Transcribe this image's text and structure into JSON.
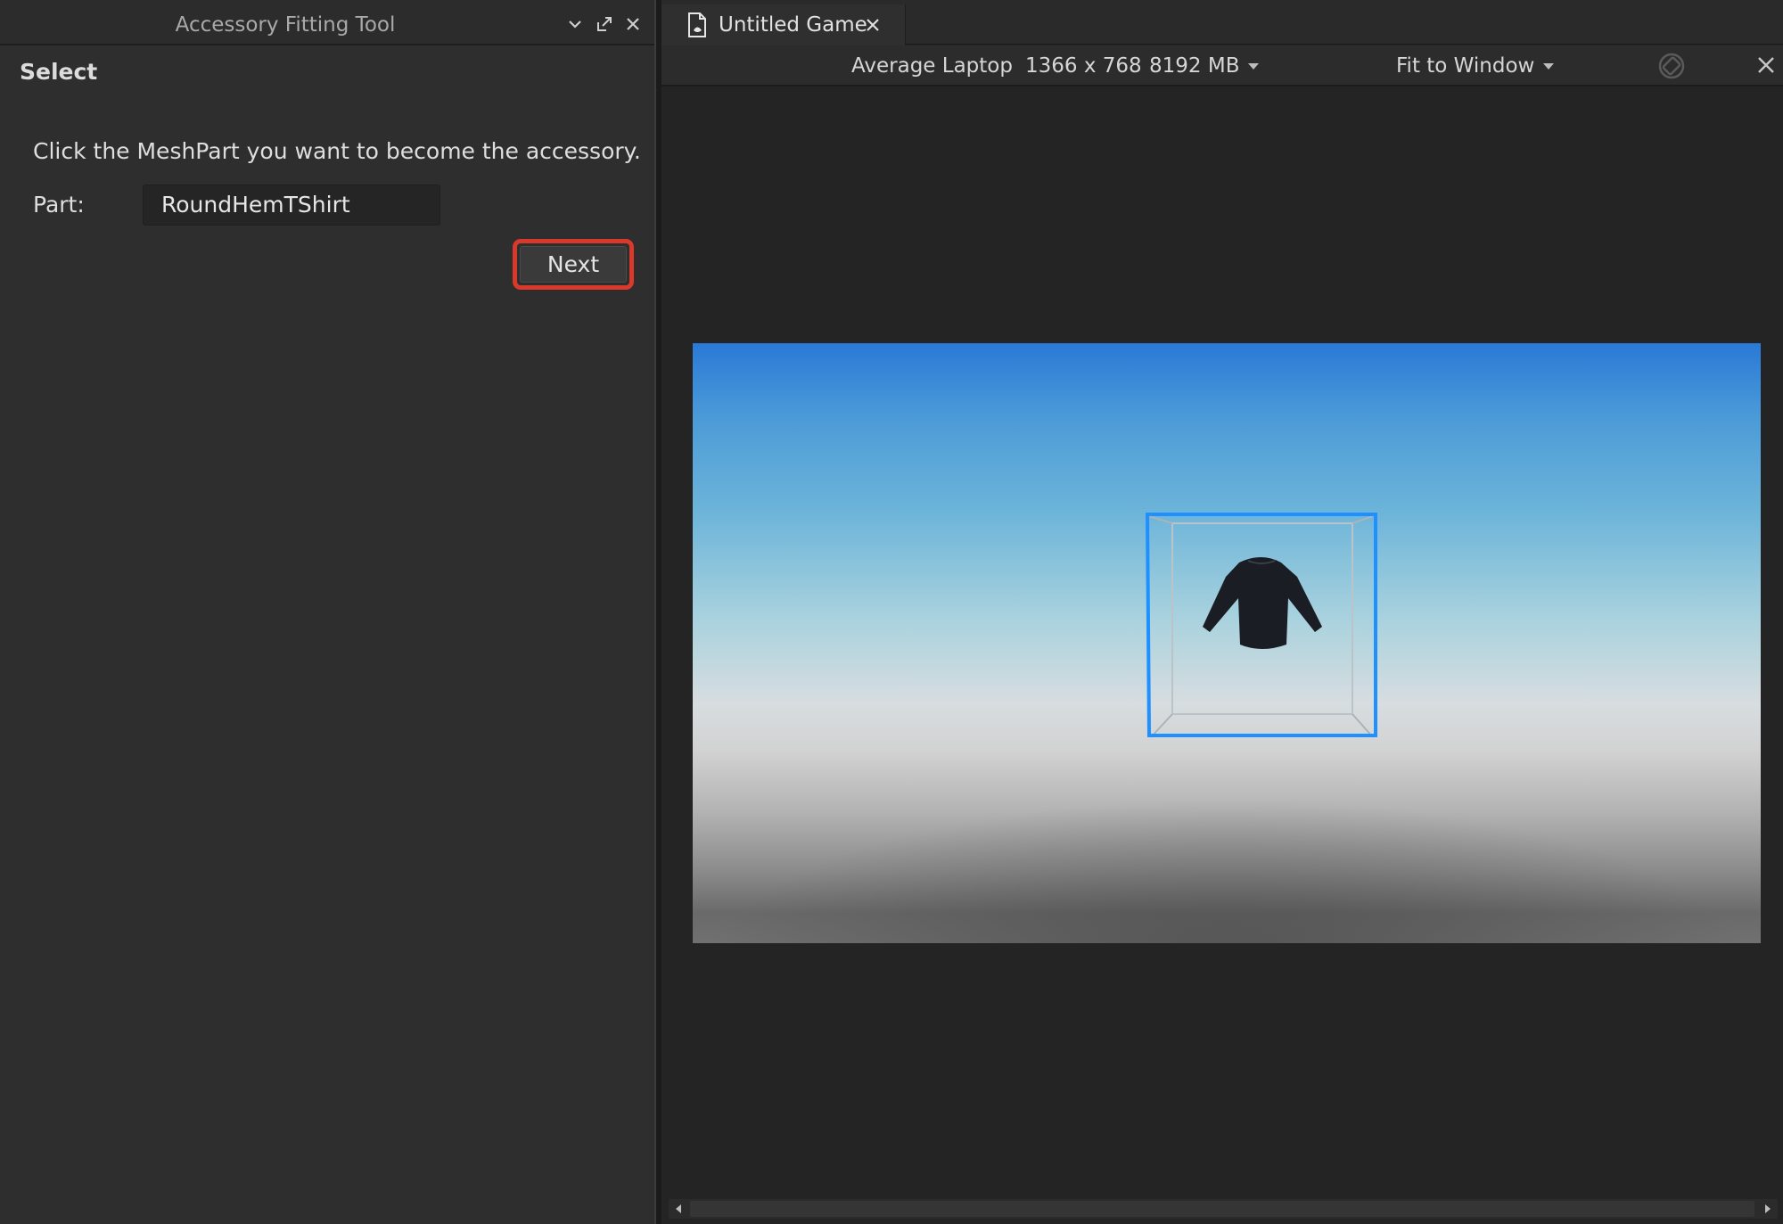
{
  "panel": {
    "title": "Accessory Fitting Tool",
    "section_header": "Select",
    "instruction": "Click the MeshPart you want to become the accessory.",
    "part_label": "Part:",
    "part_value": "RoundHemTShirt",
    "next_label": "Next"
  },
  "tabs": [
    {
      "label": "Untitled Game"
    }
  ],
  "device_bar": {
    "device": "Average Laptop",
    "resolution": "1366 x 768",
    "memory": "8192 MB",
    "fit": "Fit to Window"
  },
  "colors": {
    "highlight": "#d9392b",
    "selection": "#1e90ff",
    "sky_top": "#2a79d6"
  },
  "icons": {
    "collapse": "chevron-down-icon",
    "undock": "undock-icon",
    "close": "close-icon",
    "document": "document-icon",
    "rotate": "rotate-icon"
  }
}
